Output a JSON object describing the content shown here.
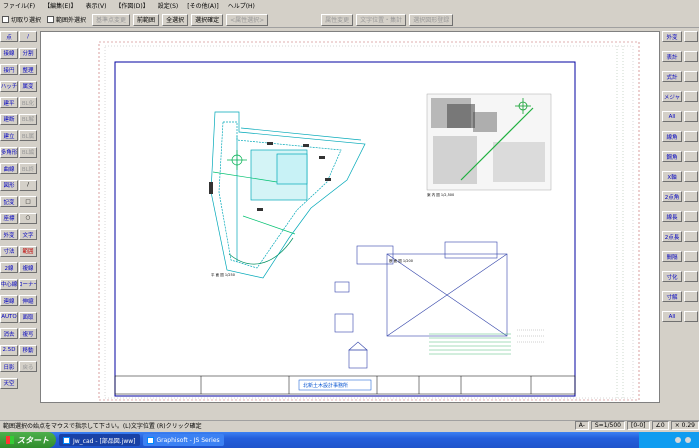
{
  "menubar": {
    "items": [
      "ファイル(F)",
      "【編集(E)】",
      "表示(V)",
      "【作図(D)】",
      "設定(S)",
      "[その他(A)]",
      "ヘルプ(H)"
    ]
  },
  "toolbar": {
    "checkbox1": "切取り選択",
    "checkbox2": "範囲外選択",
    "btn_base_change": "基準点変更",
    "btn_prev_range": "前範囲",
    "btn_select_all": "全選択",
    "btn_select_confirm": "選択確定",
    "btn_attr_select": "<属性選択>",
    "btn_attr_change": "属性変更",
    "btn_text_edit": "文字位置・集計",
    "btn_selection_arrange": "選択図形登録"
  },
  "left_tools": [
    {
      "label": "点",
      "style": "blue"
    },
    {
      "label": "/",
      "style": "blue"
    },
    {
      "label": "接線",
      "style": "blue"
    },
    {
      "label": "分割",
      "style": "blue"
    },
    {
      "label": "接円",
      "style": "blue"
    },
    {
      "label": "整理",
      "style": "blue"
    },
    {
      "label": "ハッチ",
      "style": "blue"
    },
    {
      "label": "属変",
      "style": "blue"
    },
    {
      "label": "建平",
      "style": "blue"
    },
    {
      "label": "BL化",
      "style": "dis"
    },
    {
      "label": "建断",
      "style": "blue"
    },
    {
      "label": "BL解",
      "style": "dis"
    },
    {
      "label": "建立",
      "style": "blue"
    },
    {
      "label": "BL属",
      "style": "dis"
    },
    {
      "label": "多角形",
      "style": "blue"
    },
    {
      "label": "BL編",
      "style": "dis"
    },
    {
      "label": "曲線",
      "style": "blue"
    },
    {
      "label": "BL終",
      "style": "dis"
    },
    {
      "label": "図形",
      "style": "blue"
    },
    {
      "label": "/",
      "style": ""
    },
    {
      "label": "記変",
      "style": "blue"
    },
    {
      "label": "□",
      "style": ""
    },
    {
      "label": "座標",
      "style": "blue"
    },
    {
      "label": "○",
      "style": ""
    },
    {
      "label": "外変",
      "style": "blue"
    },
    {
      "label": "文字",
      "style": "blue"
    },
    {
      "label": "寸法",
      "style": "blue"
    },
    {
      "label": "範囲",
      "style": "red"
    },
    {
      "label": "2線",
      "style": "blue"
    },
    {
      "label": "複線",
      "style": "blue"
    },
    {
      "label": "中心線",
      "style": "blue"
    },
    {
      "label": "コーナー",
      "style": "blue"
    },
    {
      "label": "連線",
      "style": "blue"
    },
    {
      "label": "伸縮",
      "style": "blue"
    },
    {
      "label": "AUTO",
      "style": "blue"
    },
    {
      "label": "面取",
      "style": "blue"
    },
    {
      "label": "消去",
      "style": "blue"
    },
    {
      "label": "複写",
      "style": "blue"
    },
    {
      "label": "2.5D",
      "style": "blue"
    },
    {
      "label": "移動",
      "style": "blue"
    },
    {
      "label": "日影",
      "style": "blue"
    },
    {
      "label": "戻る",
      "style": "dis"
    },
    {
      "label": "天空",
      "style": "blue"
    }
  ],
  "right_tools": [
    {
      "label": "外変",
      "style": "blue"
    },
    {
      "label": "表計",
      "style": "blue"
    },
    {
      "label": "式計",
      "style": "blue"
    },
    {
      "label": "メジャ",
      "style": "blue"
    },
    {
      "label": "All",
      "style": "blue"
    },
    {
      "label": "線角",
      "style": "blue"
    },
    {
      "label": "鋼角",
      "style": "blue"
    },
    {
      "label": "X軸",
      "style": "blue"
    },
    {
      "label": "2点角",
      "style": "blue"
    },
    {
      "label": "線長",
      "style": "blue"
    },
    {
      "label": "2点長",
      "style": "blue"
    },
    {
      "label": "間隔",
      "style": "blue"
    },
    {
      "label": "寸化",
      "style": "blue"
    },
    {
      "label": "寸解",
      "style": "blue"
    },
    {
      "label": "All",
      "style": "blue"
    }
  ],
  "drawing": {
    "title_box": "北新土木設計事務所",
    "plan_label": "平 面 図   1/250",
    "site_label": "案 内 図   1/2,500",
    "section_label": "断 面 図   1/200"
  },
  "status": {
    "message": "範囲選択の始点をマウスで指示して下さい。(L)文字位置 (R)クリック確定",
    "scale_a": "A-",
    "scale": "S=1/500",
    "layer": "[0-0]",
    "zoom": "∠0",
    "coord": "× 0.29"
  },
  "taskbar": {
    "start": "スタート",
    "task1": "Jw_cad - [部品図.jww]",
    "task2": "Graphisoft - JS Series",
    "time": ""
  }
}
